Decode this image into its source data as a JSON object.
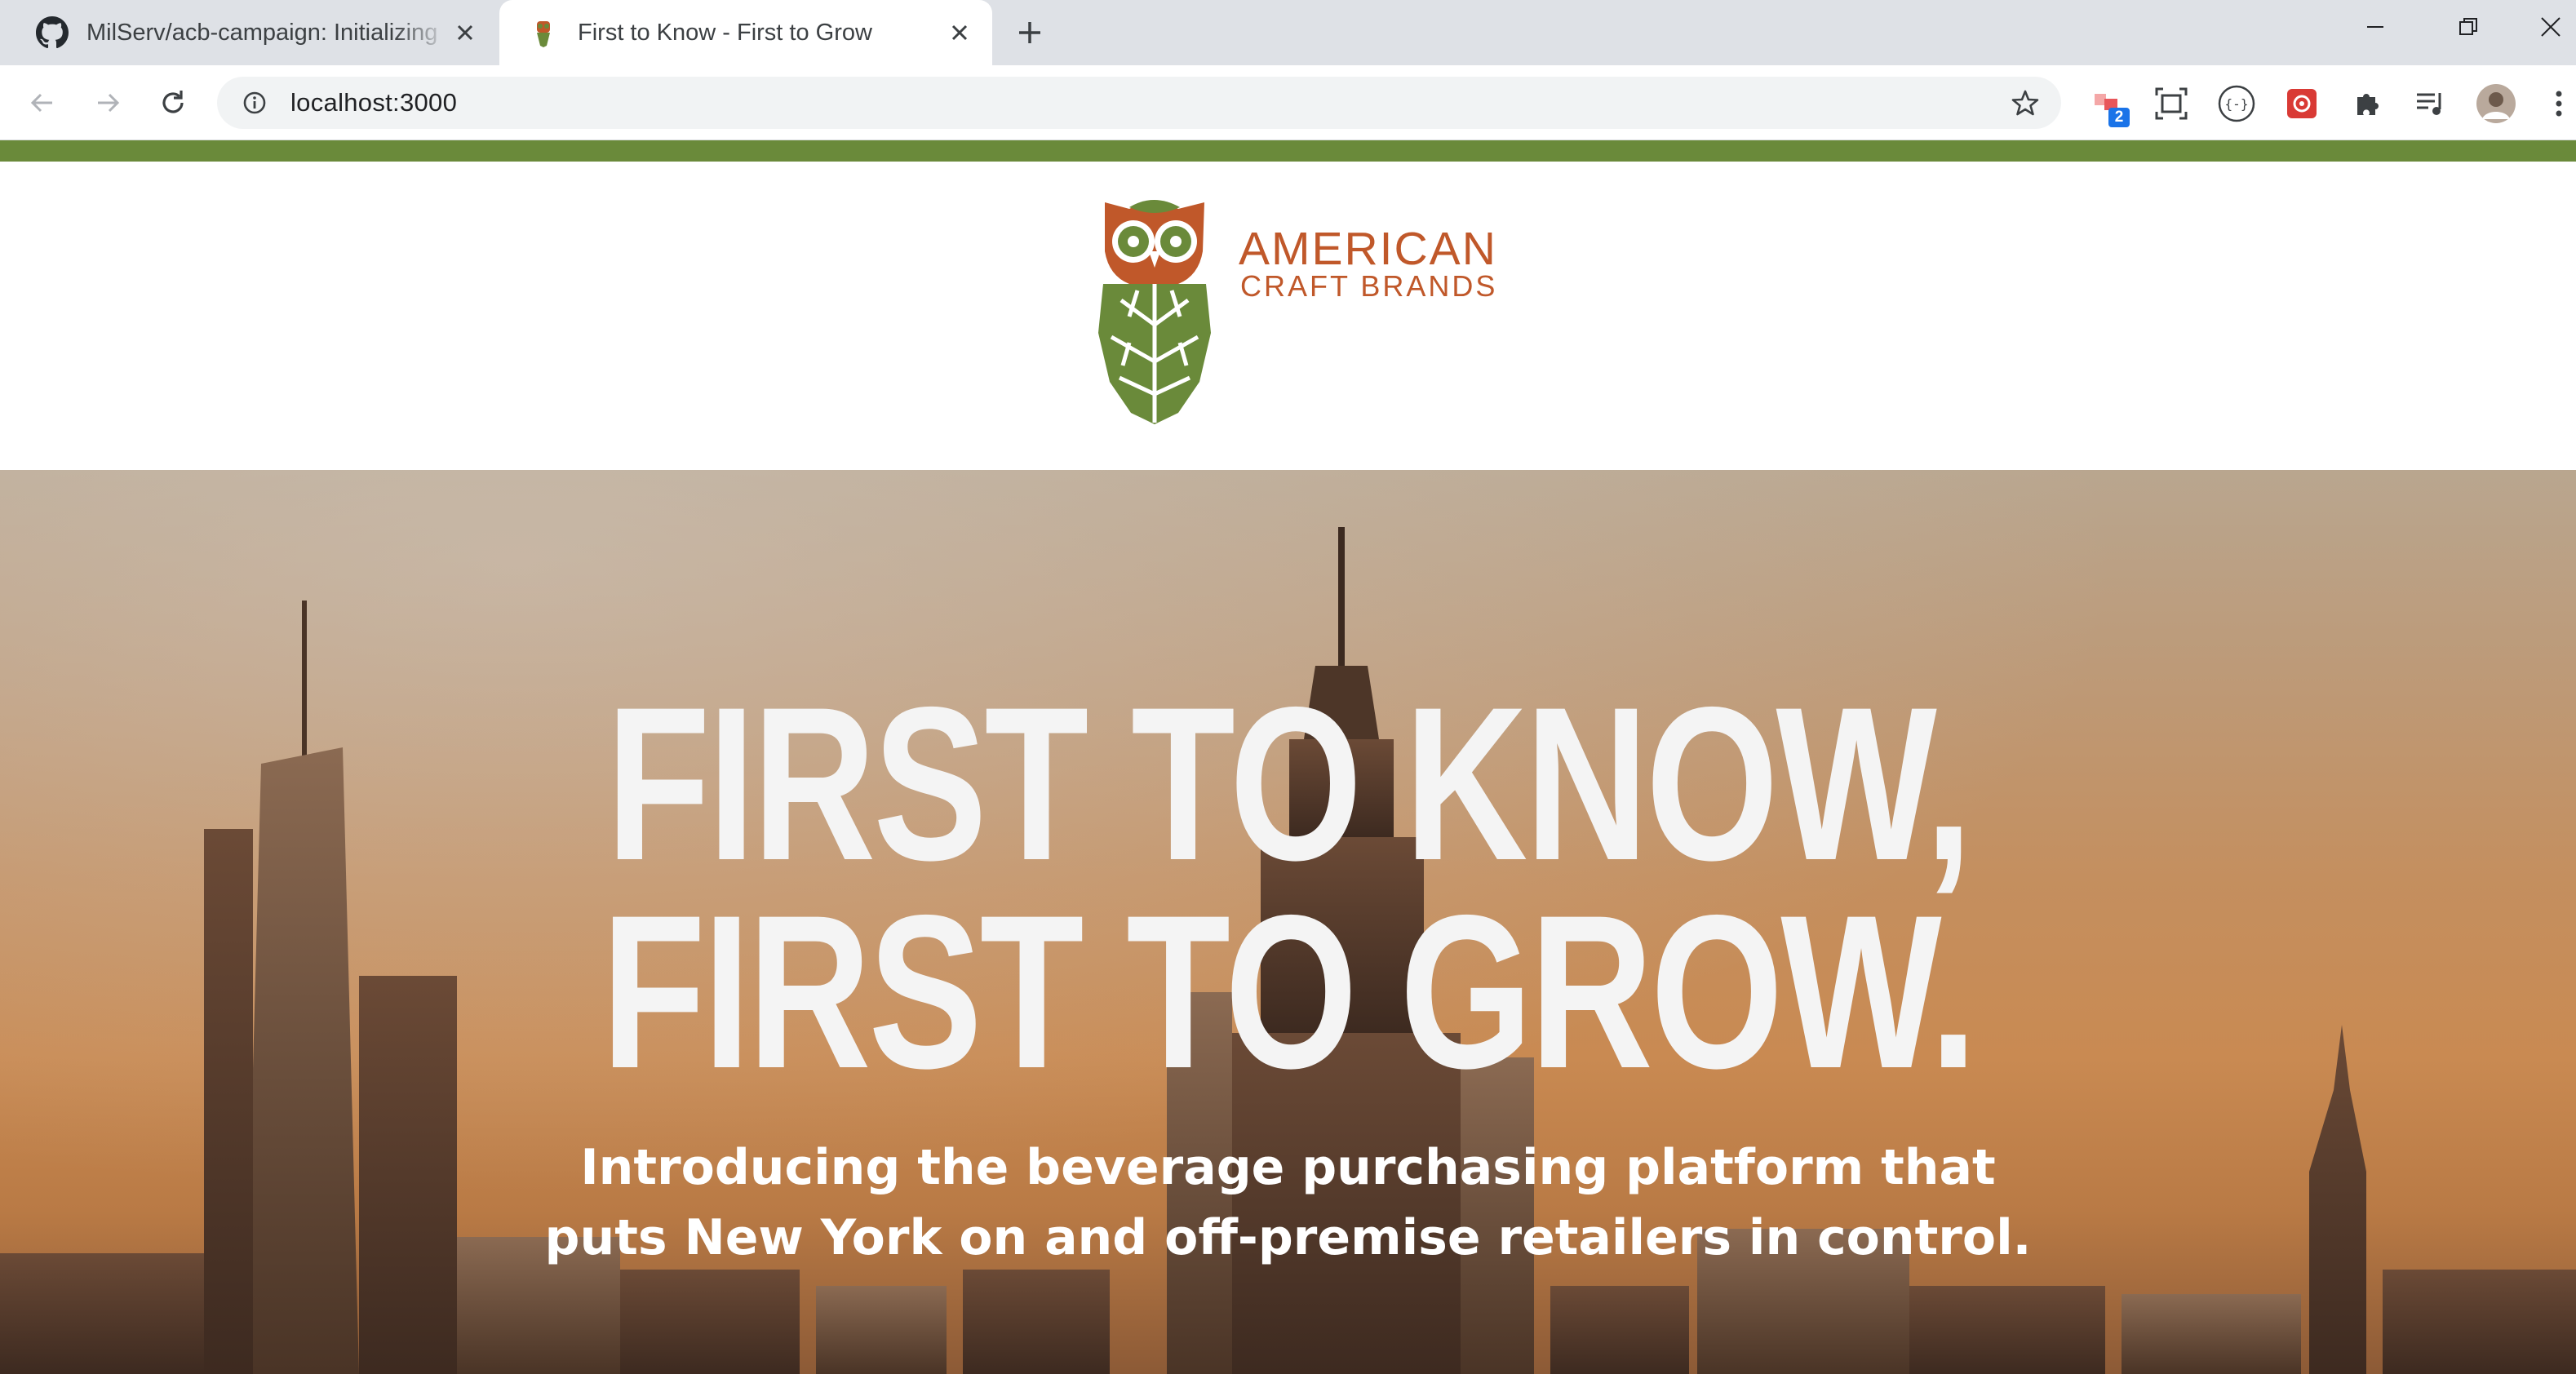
{
  "browser": {
    "tabs": [
      {
        "title": "MilServ/acb-campaign: Initializing",
        "favicon": "github-icon",
        "active": false
      },
      {
        "title": "First to Know - First to Grow",
        "favicon": "owl-favicon",
        "active": true
      }
    ],
    "url": "localhost:3000",
    "extension_badge": "2"
  },
  "colors": {
    "brand_green": "#6a8a3a",
    "brand_orange": "#c0582a",
    "hero_text": "#f4f4f4"
  },
  "logo": {
    "line1": "AMERICAN",
    "line2": "CRAFT BRANDS"
  },
  "hero": {
    "title_line1": "FIRST TO KNOW,",
    "title_line2": "FIRST TO GROW.",
    "subtitle_line1": "Introducing the beverage purchasing platform that",
    "subtitle_line2": "puts New York on and off-premise retailers in control."
  }
}
